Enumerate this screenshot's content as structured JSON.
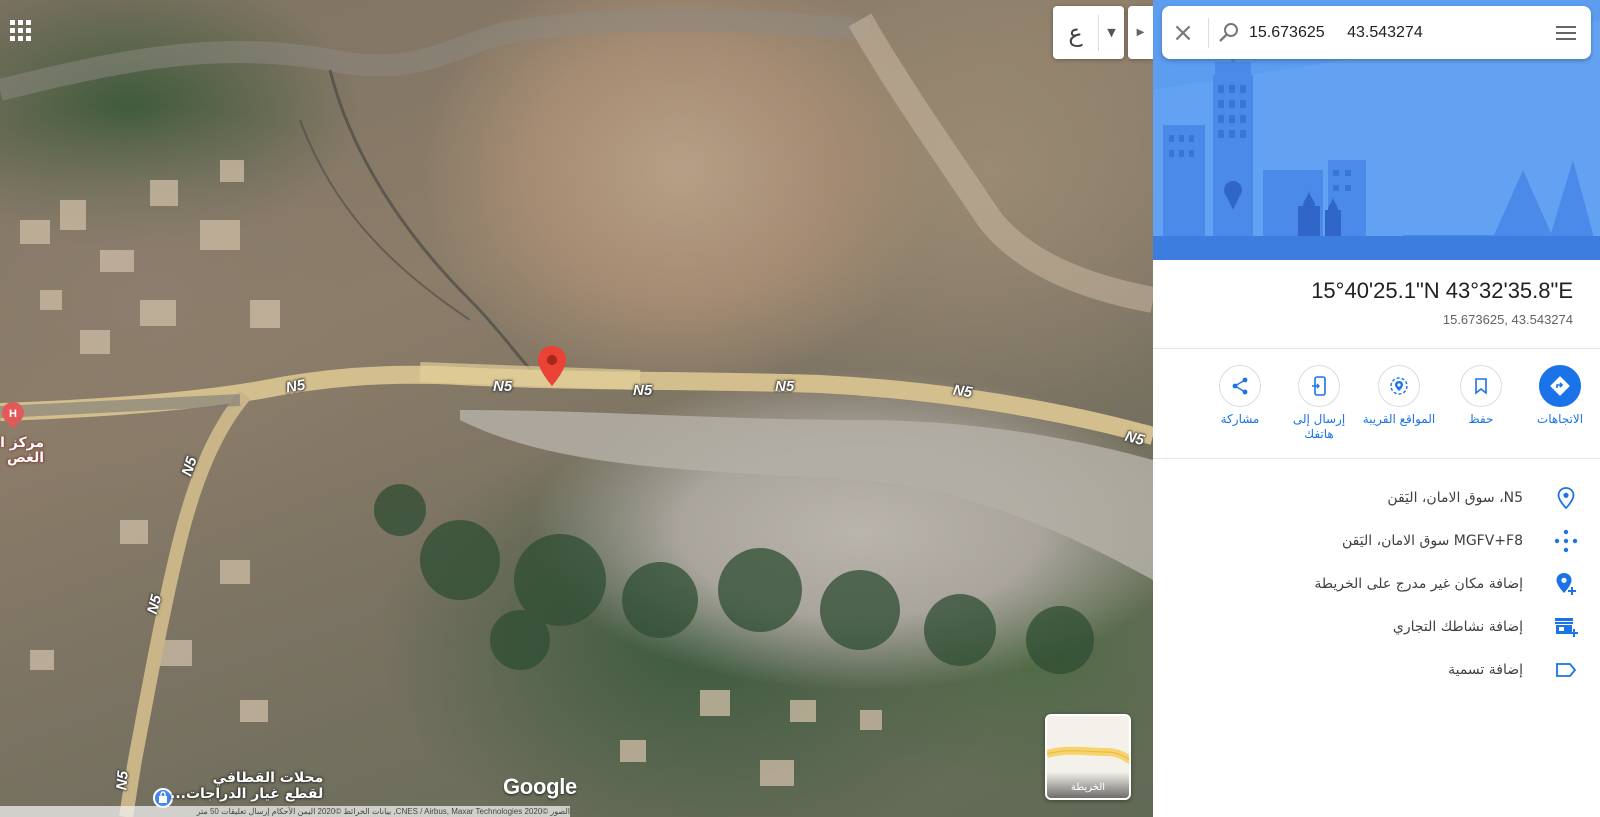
{
  "map": {
    "road_labels": [
      "N5",
      "N5",
      "N5",
      "N5",
      "N5",
      "N5",
      "N5",
      "N5",
      "N5"
    ],
    "place_hospital_line1": "مركز ا",
    "place_hospital_line2": "الغص",
    "shop_line1": "محلات القطافي",
    "shop_line2": "لقطع غيار الدراجات...",
    "google_logo": "Google",
    "attribution": "الصور ©2020 CNES / Airbus, Maxar Technologies, بيانات الخرائط ©2020   اليمن   الأحكام   إرسال تعليقات   50 متر",
    "thumbnail_label": "الخريطة",
    "language_glyph": "ع"
  },
  "search": {
    "value": "15.673625 43.543274"
  },
  "place": {
    "title": "15°40'25.1\"N 43°32'35.8\"E",
    "subtitle": "15.673625, 43.543274"
  },
  "actions": {
    "directions": "الاتجاهات",
    "save": "حفظ",
    "nearby": "المواقع القريبة",
    "send_line1": "إرسال إلى",
    "send_line2": "هاتفك",
    "share": "مشاركة"
  },
  "info": {
    "address": "N5، سوق الامان، اليَقن",
    "plus_code": "MGFV+F8 سوق الامان، اليَقن",
    "add_missing_place": "إضافة مكان غير مدرج على الخريطة",
    "add_business": "إضافة نشاطك التجاري",
    "add_label": "إضافة تسمية"
  },
  "colors": {
    "accent": "#1a73e8",
    "pin": "#ea4335",
    "hero": "#5c9df0"
  }
}
